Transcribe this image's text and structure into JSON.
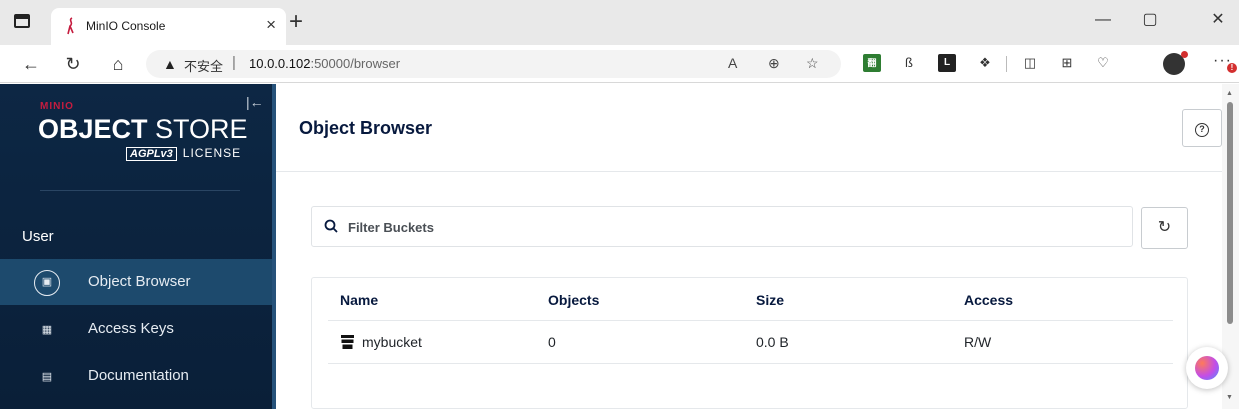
{
  "browser": {
    "tab_title": "MinIO Console",
    "tab_close": "×",
    "new_tab": "+",
    "minimize": "—",
    "maximize": "▢",
    "close": "✕",
    "back": "←",
    "reload": "↻",
    "home": "⌂",
    "security_warning": "▲",
    "security_label": "不安全",
    "url_separator": "|",
    "url_host": "10.0.0.102",
    "url_rest": ":50000/browser",
    "read_aloud": "A",
    "zoom": "⊕",
    "favorite": "☆",
    "more": "···",
    "notification_badge": "!"
  },
  "sidebar": {
    "logo_brand": "MINIO",
    "logo_title_bold": "OBJECT",
    "logo_title_light": " STORE",
    "logo_agpl": "AGPLv3",
    "logo_license": "LICENSE",
    "collapse_glyph": "|←",
    "section_title": "User",
    "items": [
      {
        "label": "Object Browser",
        "active": true
      },
      {
        "label": "Access Keys",
        "active": false
      },
      {
        "label": "Documentation",
        "active": false
      }
    ]
  },
  "main": {
    "title": "Object Browser",
    "filter_placeholder": "Filter Buckets",
    "table": {
      "headers": [
        "Name",
        "Objects",
        "Size",
        "Access"
      ],
      "rows": [
        {
          "name": "mybucket",
          "objects": "0",
          "size": "0.0 B",
          "access": "R/W"
        }
      ]
    }
  },
  "colors": {
    "sidebar_bg": "#0d2744",
    "sidebar_active": "#1d4a6d",
    "title_text": "#07193e",
    "brand_red": "#c51c3f"
  }
}
